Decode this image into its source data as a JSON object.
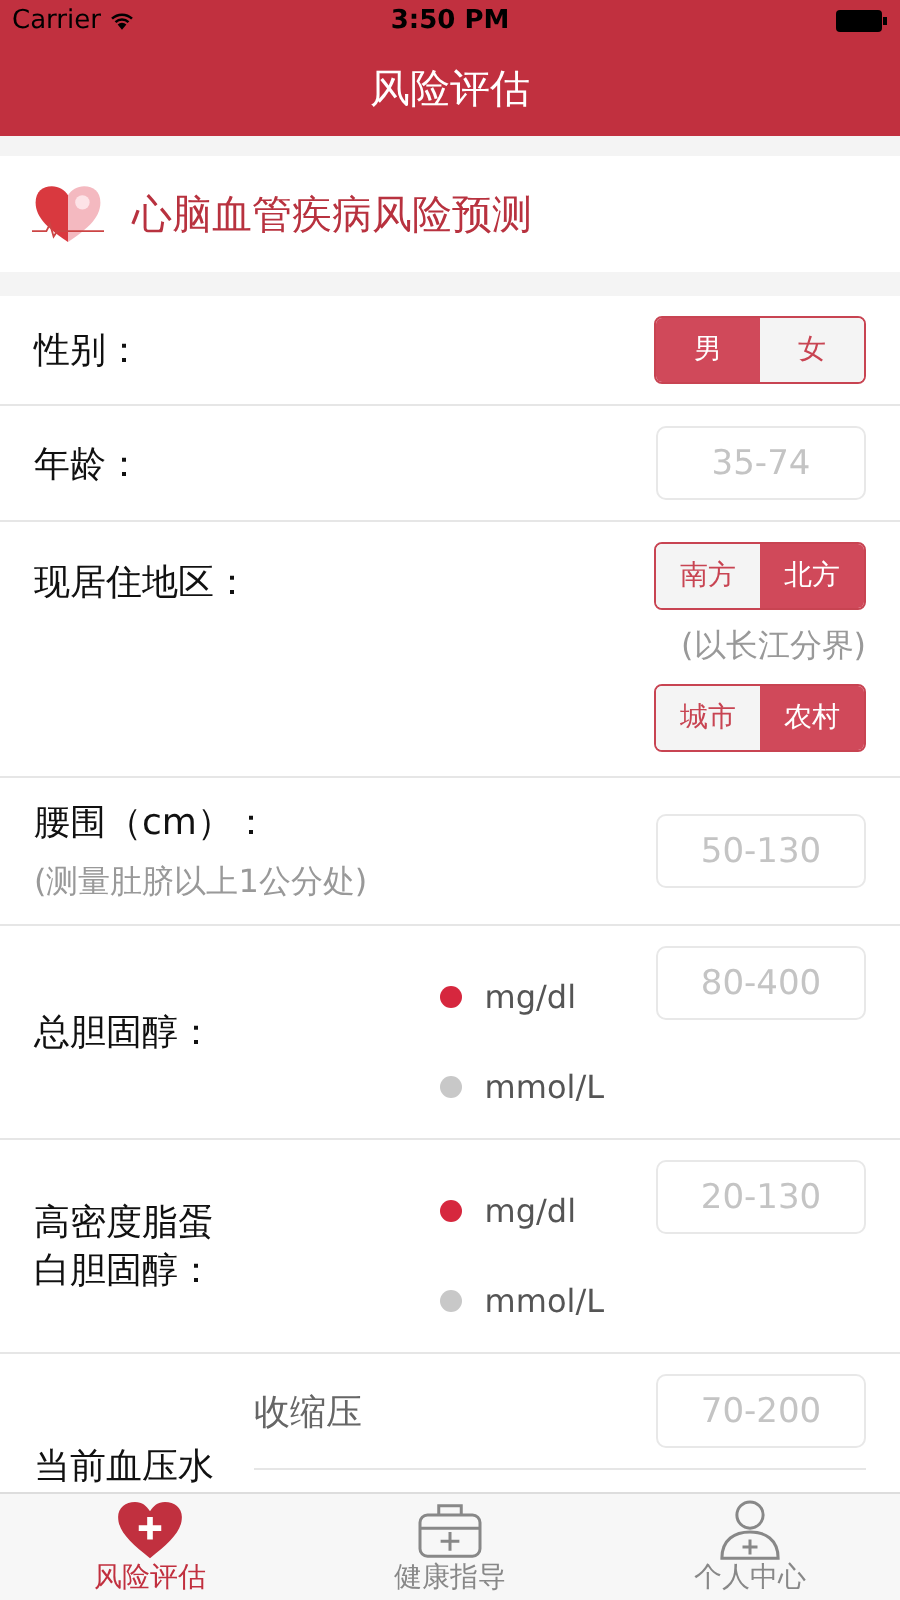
{
  "status_bar": {
    "carrier": "Carrier",
    "time": "3:50 PM"
  },
  "nav": {
    "title": "风险评估"
  },
  "section": {
    "title": "心脑血管疾病风险预测"
  },
  "rows": [
    {
      "kind": "toggle",
      "label": "性别：",
      "groups": [
        [
          {
            "label": "男",
            "selected": true
          },
          {
            "label": "女",
            "selected": false
          }
        ]
      ]
    },
    {
      "kind": "input",
      "label": "年龄：",
      "placeholder": "35-74"
    },
    {
      "kind": "toggle",
      "label": "现居住地区：",
      "note": "(以长江分界)",
      "groups": [
        [
          {
            "label": "南方",
            "selected": false
          },
          {
            "label": "北方",
            "selected": true
          }
        ],
        [
          {
            "label": "城市",
            "selected": false
          },
          {
            "label": "农村",
            "selected": true
          }
        ]
      ]
    },
    {
      "kind": "input",
      "label": "腰围（cm）：",
      "hint": "(测量肚脐以上1公分处)",
      "placeholder": "50-130"
    },
    {
      "kind": "units",
      "label": "总胆固醇：",
      "placeholder": "80-400",
      "units": [
        {
          "label": "mg/dl",
          "selected": true
        },
        {
          "label": "mmol/L",
          "selected": false
        }
      ]
    },
    {
      "kind": "units",
      "label": "高密度脂蛋白胆固醇：",
      "placeholder": "20-130",
      "units": [
        {
          "label": "mg/dl",
          "selected": true
        },
        {
          "label": "mmol/L",
          "selected": false
        }
      ]
    },
    {
      "kind": "pressure",
      "label": "当前血压水",
      "sub_label": "收缩压",
      "placeholder": "70-200"
    }
  ],
  "tab_bar": [
    {
      "kind": "heart",
      "label": "风险评估",
      "selected": true
    },
    {
      "kind": "case",
      "label": "健康指导",
      "selected": false
    },
    {
      "kind": "person",
      "label": "个人中心",
      "selected": false
    }
  ]
}
